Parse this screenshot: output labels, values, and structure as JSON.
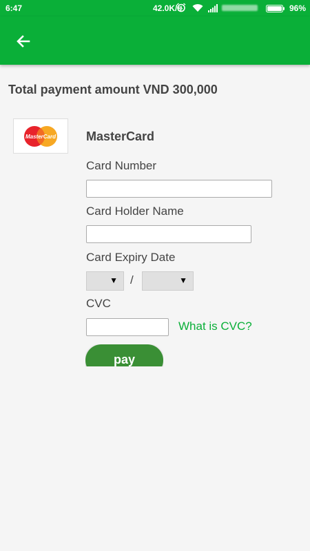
{
  "status_bar": {
    "time": "6:47",
    "net_speed": "42.0K/s",
    "battery_pct": "96%"
  },
  "toolbar": {
    "back_icon": "arrow-left-icon"
  },
  "payment": {
    "total_label": "Total payment amount VND 300,000",
    "card_brand": "MasterCard",
    "logo_text": "MasterCard"
  },
  "form": {
    "card_number_label": "Card Number",
    "card_number_value": "",
    "holder_name_label": "Card Holder Name",
    "holder_name_value": "",
    "expiry_label": "Card Expiry Date",
    "expiry_month": "",
    "expiry_year": "",
    "expiry_separator": "/",
    "cvc_label": "CVC",
    "cvc_value": "",
    "cvc_help": "What is CVC?",
    "pay_label": "pay"
  },
  "colors": {
    "brand_green": "#0aaf38",
    "pay_green": "#3a8f35"
  }
}
